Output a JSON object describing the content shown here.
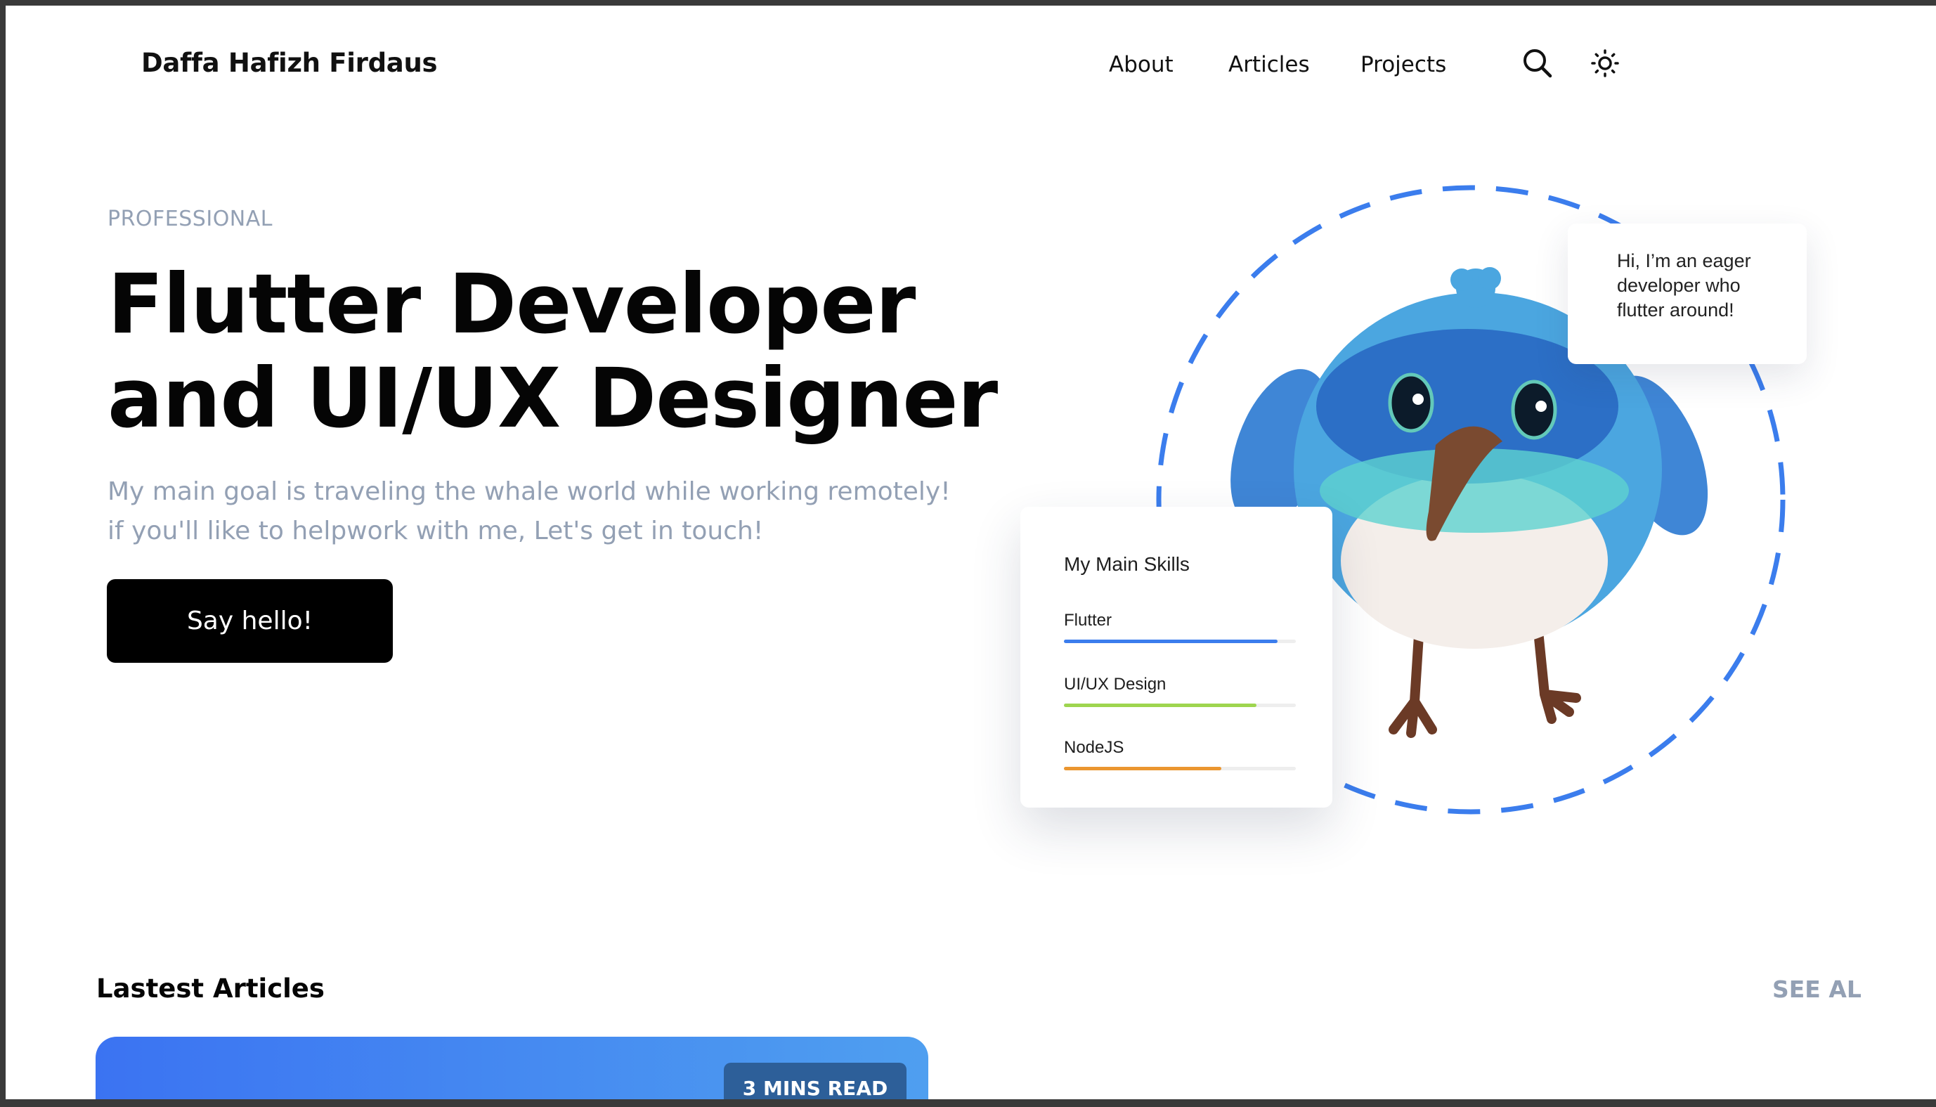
{
  "header": {
    "brand": "Daffa Hafizh Firdaus",
    "nav": [
      "About",
      "Articles",
      "Projects"
    ],
    "icons": [
      "search-icon",
      "sun-icon"
    ]
  },
  "hero": {
    "eyebrow": "PROFESSIONAL",
    "title_line1": "Flutter Developer",
    "title_line2": "and UI/UX Designer",
    "subtitle_line1": "My main goal is traveling the whale world while working remotely!",
    "subtitle_line2": "if you'll like to helpwork with me, Let's get in touch!",
    "cta_label": "Say hello!"
  },
  "bubble": {
    "text": "Hi, I’m an eager developer who flutter around!"
  },
  "skills": {
    "title": "My Main Skills",
    "items": [
      {
        "label": "Flutter",
        "level": 0.92,
        "color": "#3b7ded"
      },
      {
        "label": "UI/UX Design",
        "level": 0.83,
        "color": "#9ed54f"
      },
      {
        "label": "NodeJS",
        "level": 0.68,
        "color": "#eb9630"
      }
    ]
  },
  "articles": {
    "heading": "Lastest Articles",
    "see_all": "SEE AL",
    "card_badge": "3 MINS READ"
  },
  "colors": {
    "accent": "#3b7ded",
    "muted": "#93a0b4",
    "cta_bg": "#000000"
  }
}
